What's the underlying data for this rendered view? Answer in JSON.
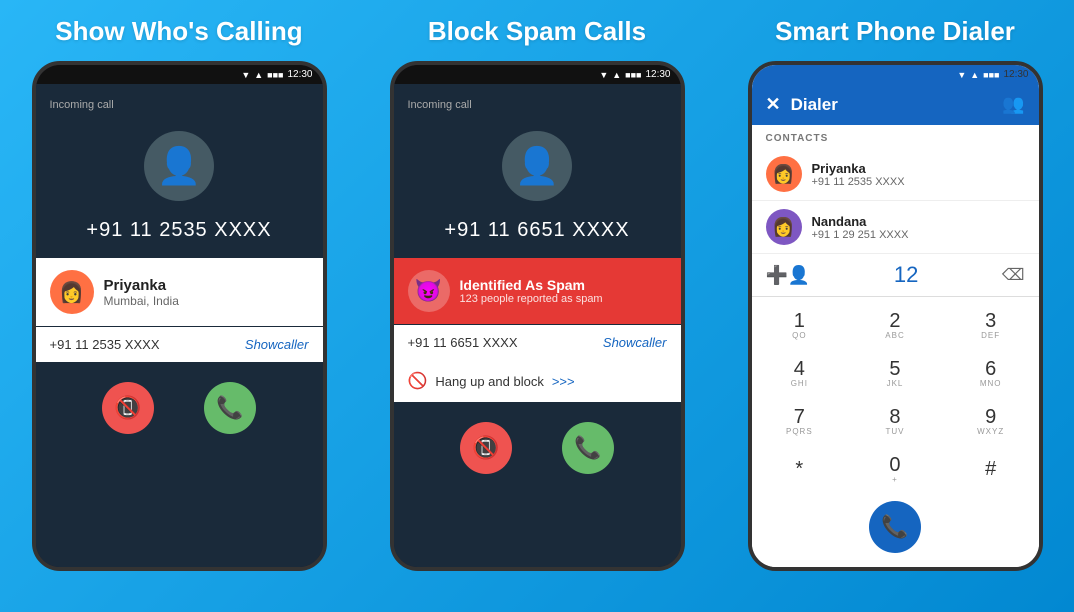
{
  "sections": [
    {
      "id": "show-calling",
      "title": "Show Who's Calling",
      "statusTime": "12:30",
      "incomingLabel": "Incoming call",
      "phoneNumber": "+91 11 2535 XXXX",
      "callerName": "Priyanka",
      "callerLocation": "Mumbai, India",
      "callerNumber": "+91 11 2535 XXXX",
      "showcallerLabel": "Showcaller",
      "declineBtnLabel": "✆",
      "acceptBtnLabel": "✆"
    },
    {
      "id": "block-spam",
      "title": "Block Spam Calls",
      "statusTime": "12:30",
      "incomingLabel": "Incoming call",
      "phoneNumber": "+91 11 6651 XXXX",
      "spamTitle": "Identified As Spam",
      "spamSub": "123 people reported as spam",
      "callerNumber": "+91 11 6651 XXXX",
      "showcallerLabel": "Showcaller",
      "hangupText": "Hang up and block",
      "hangupArrow": ">>>",
      "declineBtnLabel": "✆",
      "acceptBtnLabel": "✆"
    },
    {
      "id": "smart-dialer",
      "title": "Smart Phone Dialer",
      "statusTime": "12:30",
      "dialerTitle": "Dialer",
      "contactsLabel": "CONTACTS",
      "contacts": [
        {
          "name": "Priyanka",
          "number": "+91 11 2535 XXXX",
          "color": "#ff7043"
        },
        {
          "name": "Nandana",
          "number": "+91 1 29 251 XXXX",
          "color": "#7e57c2"
        }
      ],
      "dialInput": "12",
      "dialKeys": [
        {
          "num": "1",
          "letters": "QO"
        },
        {
          "num": "2",
          "letters": "ABC"
        },
        {
          "num": "3",
          "letters": "DEF"
        },
        {
          "num": "4",
          "letters": "GHI"
        },
        {
          "num": "5",
          "letters": "JKL"
        },
        {
          "num": "6",
          "letters": "MNO"
        },
        {
          "num": "7",
          "letters": "PQRS"
        },
        {
          "num": "8",
          "letters": "TUV"
        },
        {
          "num": "9",
          "letters": "WXYZ"
        },
        {
          "num": "*",
          "letters": ""
        },
        {
          "num": "0",
          "letters": "+"
        },
        {
          "num": "#",
          "letters": ""
        }
      ]
    }
  ]
}
